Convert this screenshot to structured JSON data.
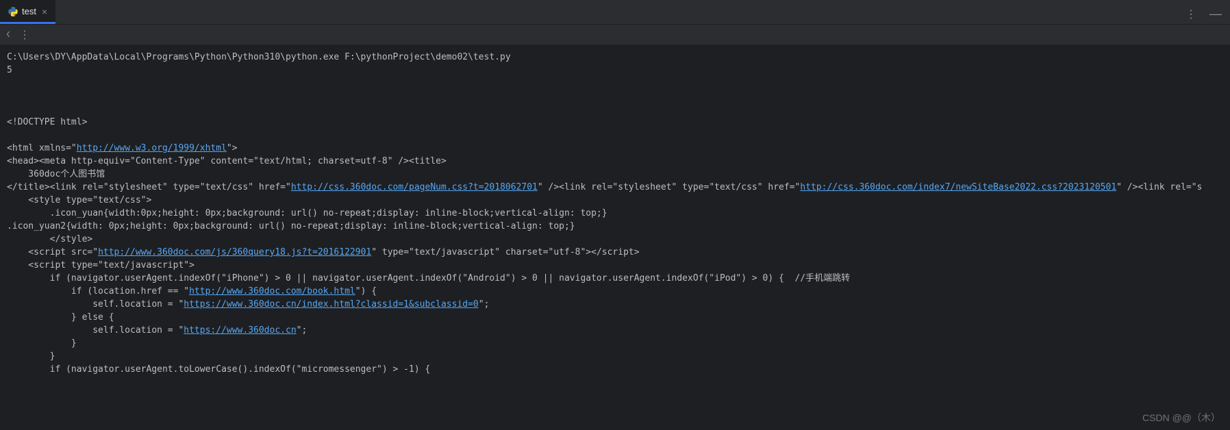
{
  "tab": {
    "label": "test"
  },
  "title_right": {
    "dots": "⋮",
    "minus": "—"
  },
  "subbar": {
    "dots": "⋮"
  },
  "watermark": "CSDN @@（木）",
  "out": {
    "l1": "C:\\Users\\DY\\AppData\\Local\\Programs\\Python\\Python310\\python.exe F:\\pythonProject\\demo02\\test.py",
    "l2": "5",
    "l3": "",
    "l4": "",
    "l5": "",
    "l6": "<!DOCTYPE html>",
    "l7": "",
    "l8a": "<html xmlns=\"",
    "l8u": "http://www.w3.org/1999/xhtml",
    "l8b": "\">",
    "l9": "<head><meta http-equiv=\"Content-Type\" content=\"text/html; charset=utf-8\" /><title>",
    "l10": "    360doc个人图书馆",
    "l11a": "</title><link rel=\"stylesheet\" type=\"text/css\" href=\"",
    "l11u1": "http://css.360doc.com/pageNum.css?t=2018062701",
    "l11b": "\" /><link rel=\"stylesheet\" type=\"text/css\" href=\"",
    "l11u2": "http://css.360doc.com/index7/newSiteBase2022.css?2023120501",
    "l11c": "\" /><link rel=\"s",
    "l12": "    <style type=\"text/css\">",
    "l13": "        .icon_yuan{width:0px;height: 0px;background: url() no-repeat;display: inline-block;vertical-align: top;}",
    "l14": ".icon_yuan2{width: 0px;height: 0px;background: url() no-repeat;display: inline-block;vertical-align: top;}",
    "l15": "        </style>",
    "l16a": "    <script src=\"",
    "l16u": "http://www.360doc.com/js/360query18.js?t=2016122901",
    "l16b": "\" type=\"text/javascript\" charset=\"utf-8\"></script>",
    "l17": "    <script type=\"text/javascript\">",
    "l18": "        if (navigator.userAgent.indexOf(\"iPhone\") > 0 || navigator.userAgent.indexOf(\"Android\") > 0 || navigator.userAgent.indexOf(\"iPod\") > 0) {  //手机端跳转",
    "l19a": "            if (location.href == \"",
    "l19u": "http://www.360doc.com/book.html",
    "l19b": "\") {",
    "l20a": "                self.location = \"",
    "l20u": "https://www.360doc.cn/index.html?classid=1&subclassid=0",
    "l20b": "\";",
    "l21": "            } else {",
    "l22a": "                self.location = \"",
    "l22u": "https://www.360doc.cn",
    "l22b": "\";",
    "l23": "            }",
    "l24": "        }",
    "l25": "        if (navigator.userAgent.toLowerCase().indexOf(\"micromessenger\") > -1) {"
  }
}
